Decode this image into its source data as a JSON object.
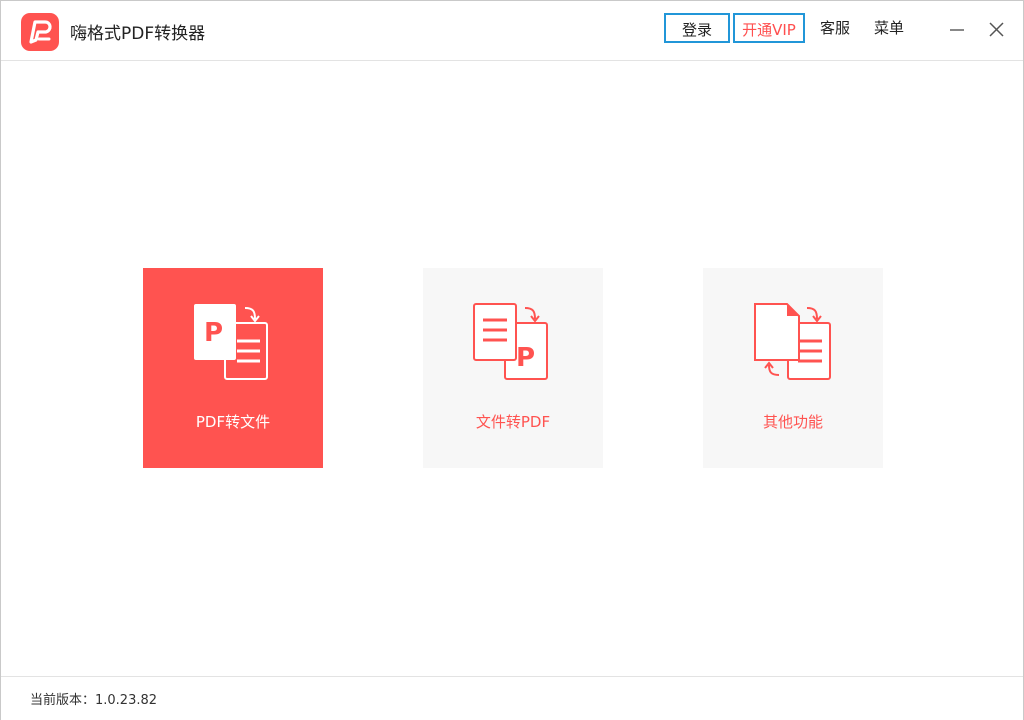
{
  "window": {
    "title": "嗨格式PDF转换器",
    "logo_icon": "app-logo-p-icon",
    "brand_color": "#ff5350"
  },
  "header": {
    "login_label": "登录",
    "vip_label": "开通VIP",
    "service_label": "客服",
    "menu_label": "菜单",
    "minimize_icon": "minimize-icon",
    "close_icon": "close-icon",
    "focus_border_color": "#2196d8"
  },
  "main": {
    "cards": [
      {
        "label": "PDF转文件",
        "icon": "pdf-to-file-icon",
        "active": true
      },
      {
        "label": "文件转PDF",
        "icon": "file-to-pdf-icon",
        "active": false
      },
      {
        "label": "其他功能",
        "icon": "other-functions-icon",
        "active": false
      }
    ]
  },
  "footer": {
    "version_text": "当前版本：1.0.23.82"
  }
}
